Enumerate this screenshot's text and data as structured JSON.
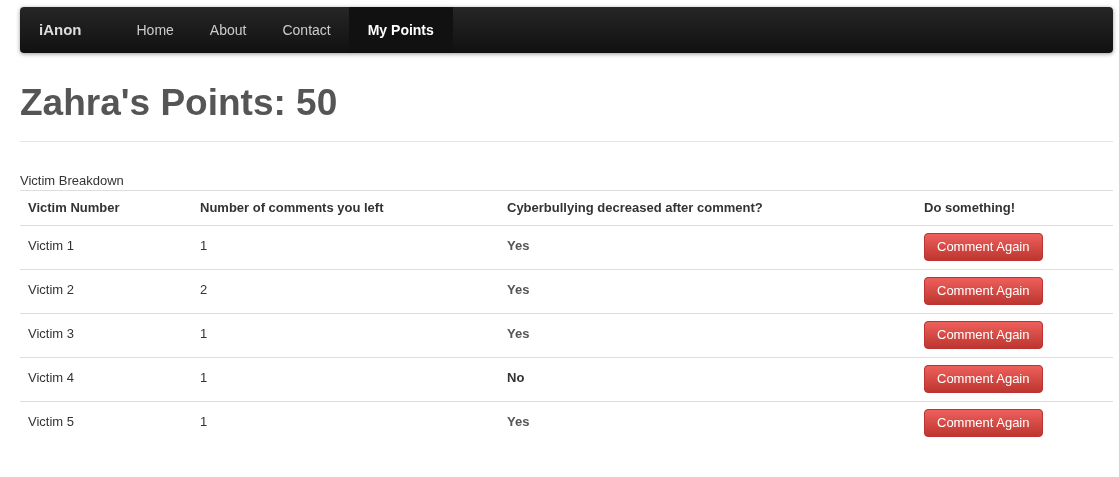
{
  "navbar": {
    "brand": "iAnon",
    "items": [
      {
        "label": "Home",
        "selected": false
      },
      {
        "label": "About",
        "selected": false
      },
      {
        "label": "Contact",
        "selected": false
      },
      {
        "label": "My Points",
        "selected": true
      }
    ]
  },
  "heading": "Zahra's Points: 50",
  "table": {
    "caption": "Victim Breakdown",
    "columns": [
      "Victim Number",
      "Number of comments you left",
      "Cyberbullying decreased after comment?",
      "Do something!"
    ],
    "rows": [
      {
        "victim": "Victim 1",
        "comments": "1",
        "decreased": "Yes",
        "emphasized": false,
        "button": "Comment Again"
      },
      {
        "victim": "Victim 2",
        "comments": "2",
        "decreased": "Yes",
        "emphasized": false,
        "button": "Comment Again"
      },
      {
        "victim": "Victim 3",
        "comments": "1",
        "decreased": "Yes",
        "emphasized": false,
        "button": "Comment Again"
      },
      {
        "victim": "Victim 4",
        "comments": "1",
        "decreased": "No",
        "emphasized": true,
        "button": "Comment Again"
      },
      {
        "victim": "Victim 5",
        "comments": "1",
        "decreased": "Yes",
        "emphasized": false,
        "button": "Comment Again"
      }
    ]
  }
}
